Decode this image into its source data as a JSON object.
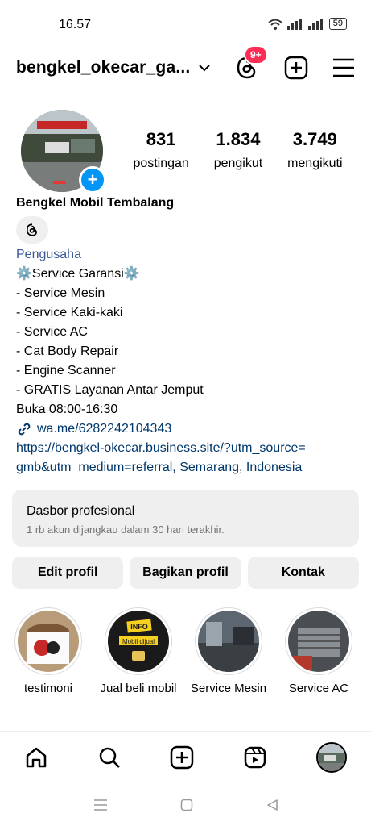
{
  "status": {
    "time": "16.57",
    "battery": "59"
  },
  "header": {
    "username": "bengkel_okecar_ga...",
    "notif_badge": "9+"
  },
  "stats": [
    {
      "value": "831",
      "label": "postingan"
    },
    {
      "value": "1.834",
      "label": "pengikut"
    },
    {
      "value": "3.749",
      "label": "mengikuti"
    }
  ],
  "profile": {
    "name": "Bengkel Mobil Tembalang",
    "category": "Pengusaha",
    "bio_lines": [
      "⚙️Service Garansi⚙️",
      "- Service Mesin",
      "- Service Kaki-kaki",
      "- Service AC",
      "- Cat Body Repair",
      "- Engine Scanner",
      "- GRATIS Layanan Antar Jemput",
      "Buka 08:00-16:30"
    ],
    "wa_link": "wa.me/6282242104343",
    "website_line1": "https://bengkel-okecar.business.site/?utm_source=",
    "website_line2": "gmb&utm_medium=referral, Semarang, Indonesia"
  },
  "dashboard": {
    "title": "Dasbor profesional",
    "subtitle": "1 rb akun dijangkau dalam 30 hari terakhir."
  },
  "buttons": {
    "edit": "Edit profil",
    "share": "Bagikan profil",
    "contact": "Kontak"
  },
  "highlights": [
    {
      "label": "testimoni"
    },
    {
      "label": "Jual beli mobil",
      "sticker_top": "INFO",
      "sticker_mid": "Mobil dijual"
    },
    {
      "label": "Service Mesin"
    },
    {
      "label": "Service AC"
    }
  ],
  "colors": {
    "accent": "#0095f6",
    "badge": "#ff2d55",
    "link": "#00376b"
  }
}
